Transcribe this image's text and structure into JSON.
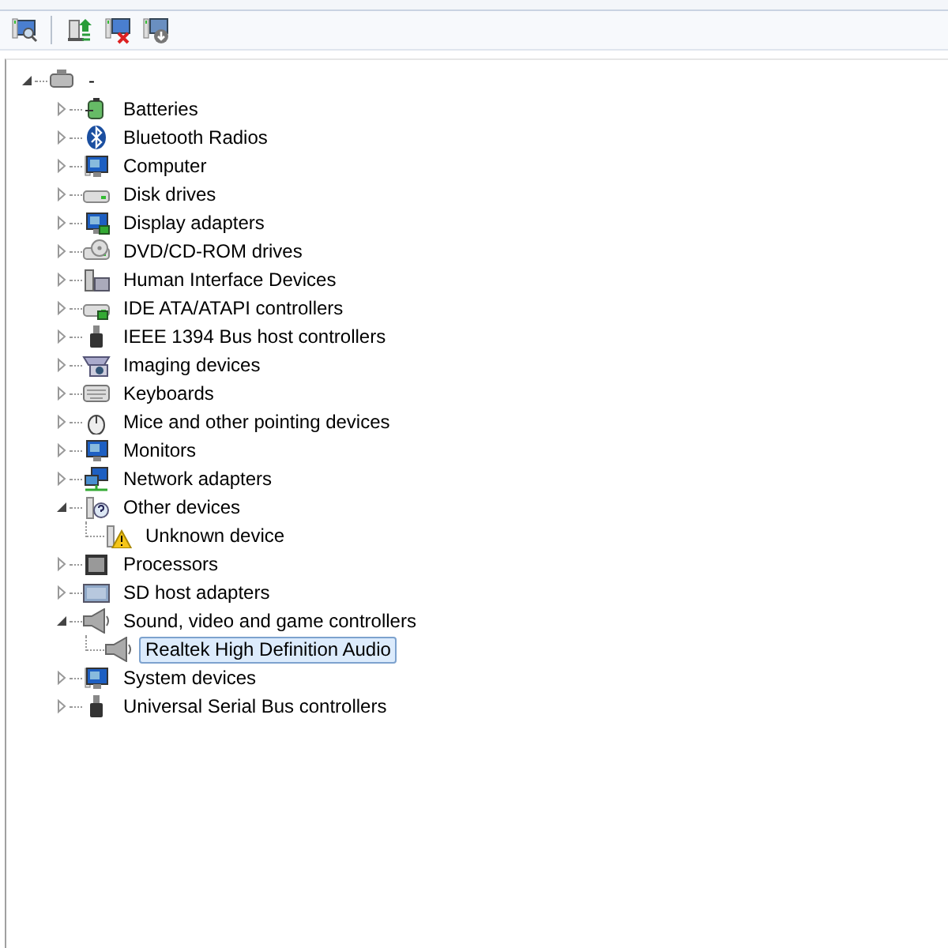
{
  "tree": {
    "root": {
      "label": "-",
      "expanded": true,
      "selected": false,
      "children": [
        {
          "label": "Batteries",
          "expanded": false,
          "selected": false
        },
        {
          "label": "Bluetooth Radios",
          "expanded": false,
          "selected": false
        },
        {
          "label": "Computer",
          "expanded": false,
          "selected": false
        },
        {
          "label": "Disk drives",
          "expanded": false,
          "selected": false
        },
        {
          "label": "Display adapters",
          "expanded": false,
          "selected": false
        },
        {
          "label": "DVD/CD-ROM drives",
          "expanded": false,
          "selected": false
        },
        {
          "label": "Human Interface Devices",
          "expanded": false,
          "selected": false
        },
        {
          "label": "IDE ATA/ATAPI controllers",
          "expanded": false,
          "selected": false
        },
        {
          "label": "IEEE 1394 Bus host controllers",
          "expanded": false,
          "selected": false
        },
        {
          "label": "Imaging devices",
          "expanded": false,
          "selected": false
        },
        {
          "label": "Keyboards",
          "expanded": false,
          "selected": false
        },
        {
          "label": "Mice and other pointing devices",
          "expanded": false,
          "selected": false
        },
        {
          "label": "Monitors",
          "expanded": false,
          "selected": false
        },
        {
          "label": "Network adapters",
          "expanded": false,
          "selected": false
        },
        {
          "label": "Other devices",
          "expanded": true,
          "selected": false,
          "children": [
            {
              "label": "Unknown device",
              "selected": false
            }
          ]
        },
        {
          "label": "Processors",
          "expanded": false,
          "selected": false
        },
        {
          "label": "SD host adapters",
          "expanded": false,
          "selected": false
        },
        {
          "label": "Sound, video and game controllers",
          "expanded": true,
          "selected": false,
          "children": [
            {
              "label": "Realtek High Definition Audio",
              "selected": true
            }
          ]
        },
        {
          "label": "System devices",
          "expanded": false,
          "selected": false
        },
        {
          "label": "Universal Serial Bus controllers",
          "expanded": false,
          "selected": false
        }
      ]
    }
  }
}
